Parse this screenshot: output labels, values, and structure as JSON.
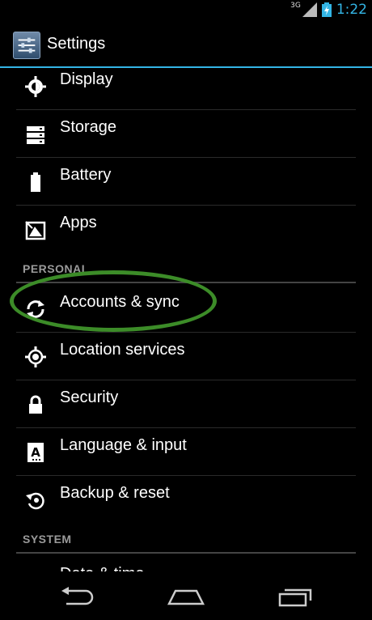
{
  "status_bar": {
    "network_type": "3G",
    "time": "1:22"
  },
  "action_bar": {
    "title": "Settings"
  },
  "list": {
    "top_items": [
      {
        "label": "Display",
        "icon": "display-brightness-icon"
      },
      {
        "label": "Storage",
        "icon": "storage-icon"
      },
      {
        "label": "Battery",
        "icon": "battery-icon"
      },
      {
        "label": "Apps",
        "icon": "apps-icon"
      }
    ],
    "personal_header": "PERSONAL",
    "personal_items": [
      {
        "label": "Accounts & sync",
        "icon": "sync-icon"
      },
      {
        "label": "Location services",
        "icon": "location-icon"
      },
      {
        "label": "Security",
        "icon": "lock-icon"
      },
      {
        "label": "Language & input",
        "icon": "language-icon"
      },
      {
        "label": "Backup & reset",
        "icon": "backup-icon"
      }
    ],
    "system_header": "SYSTEM",
    "partial_item_label": "Date & time"
  },
  "highlight": {
    "target": "Accounts & sync",
    "color": "#3c8c28"
  },
  "colors": {
    "accent": "#33b5e5",
    "background": "#000000"
  },
  "nav_bar": {
    "buttons": [
      "back-icon",
      "home-icon",
      "recent-apps-icon"
    ]
  }
}
